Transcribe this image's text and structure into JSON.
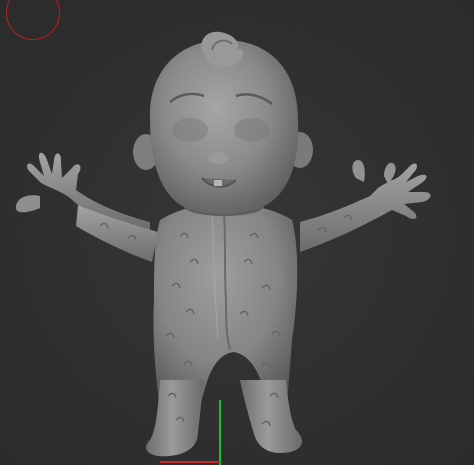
{
  "viewport": {
    "background_color": "#2f2f2f",
    "model_color": "#8c8c8c"
  },
  "cursor": {
    "icon": "brush-circle-icon",
    "color": "#b81e22"
  },
  "axes": {
    "y_color": "#1fbd33",
    "x_color": "#c8282a"
  }
}
